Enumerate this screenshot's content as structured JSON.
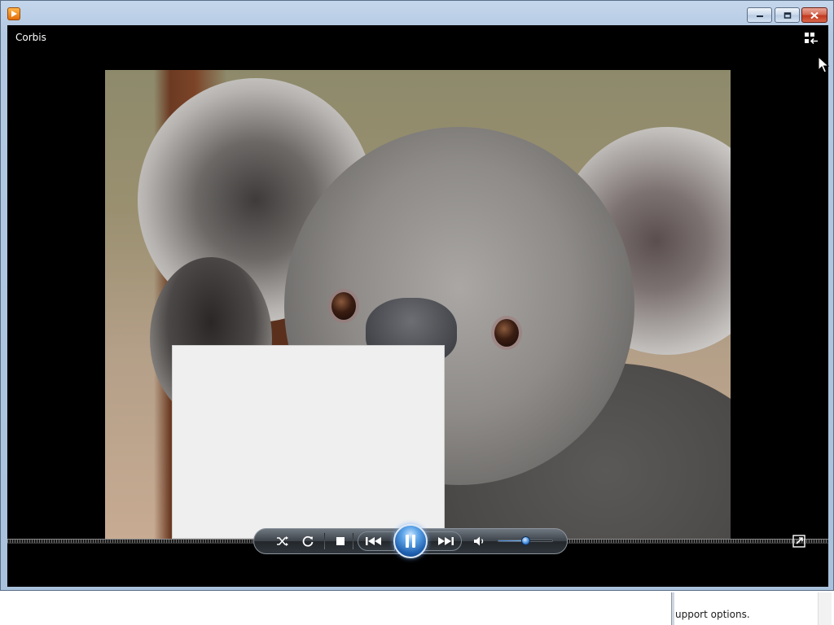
{
  "window": {
    "app_icon": "media-player-icon",
    "media_title": "Corbis",
    "caption_buttons": [
      "minimize-icon",
      "restore-icon",
      "close-icon"
    ]
  },
  "toolbar": {
    "switch_to_library_icon": "switch-to-library-icon"
  },
  "controls": {
    "shuffle_icon": "shuffle-icon",
    "repeat_icon": "repeat-icon",
    "stop_icon": "stop-icon",
    "previous_icon": "previous-icon",
    "play_pause_icon": "pause-icon",
    "next_icon": "next-icon",
    "mute_icon": "speaker-icon",
    "volume": 0.5,
    "fullscreen_icon": "fullscreen-icon"
  },
  "background_window": {
    "text": "upport options."
  },
  "colors": {
    "player_background": "#000000",
    "play_button": "#2f7ad0",
    "window_frame": "#b3c9e2",
    "close_button": "#c2391f"
  }
}
